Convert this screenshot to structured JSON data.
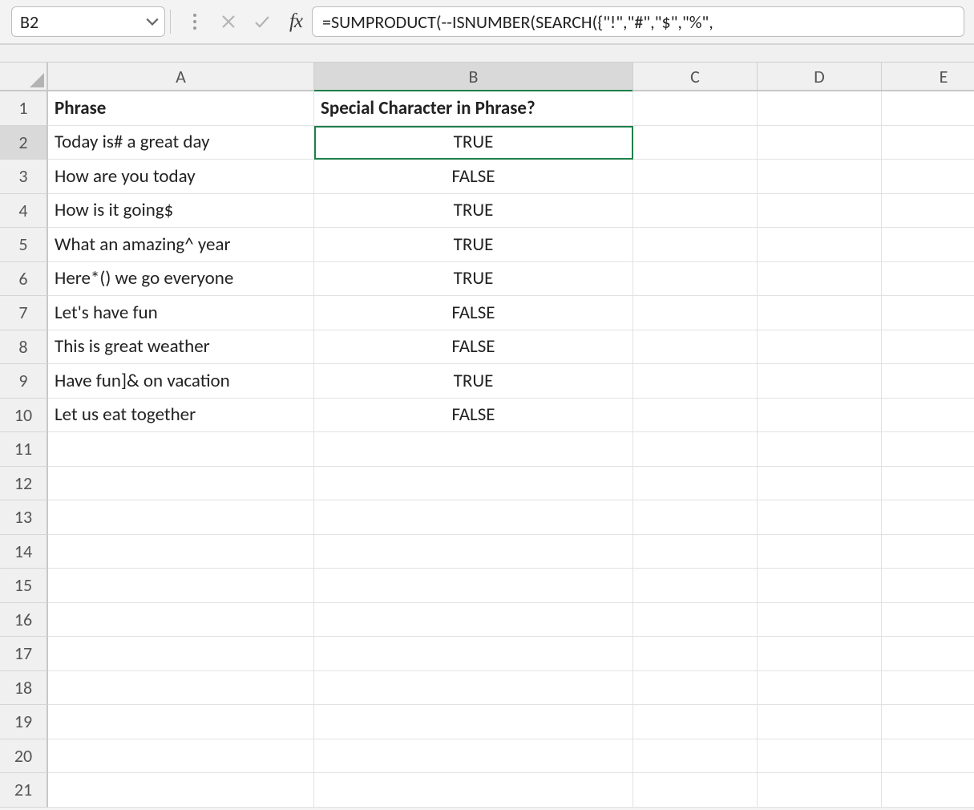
{
  "namebox": {
    "value": "B2"
  },
  "formula_bar": {
    "value": "=SUMPRODUCT(--ISNUMBER(SEARCH({\"!\",\"#\",\"$\",\"%\","
  },
  "columns": [
    "A",
    "B",
    "C",
    "D",
    "E"
  ],
  "selected_cell": {
    "col": "B",
    "row": 2
  },
  "row_count": 21,
  "headers": {
    "A": "Phrase",
    "B": "Special Character in Phrase?"
  },
  "rows": [
    {
      "A": "Today is# a great day",
      "B": "TRUE"
    },
    {
      "A": "How are you today",
      "B": "FALSE"
    },
    {
      "A": "How is it going$",
      "B": "TRUE"
    },
    {
      "A": "What an amazing^ year",
      "B": "TRUE"
    },
    {
      "A": "Here*() we go everyone",
      "B": "TRUE"
    },
    {
      "A": "Let's have fun",
      "B": "FALSE"
    },
    {
      "A": "This is great weather",
      "B": "FALSE"
    },
    {
      "A": "Have fun]& on vacation",
      "B": "TRUE"
    },
    {
      "A": "Let us eat together",
      "B": "FALSE"
    }
  ]
}
